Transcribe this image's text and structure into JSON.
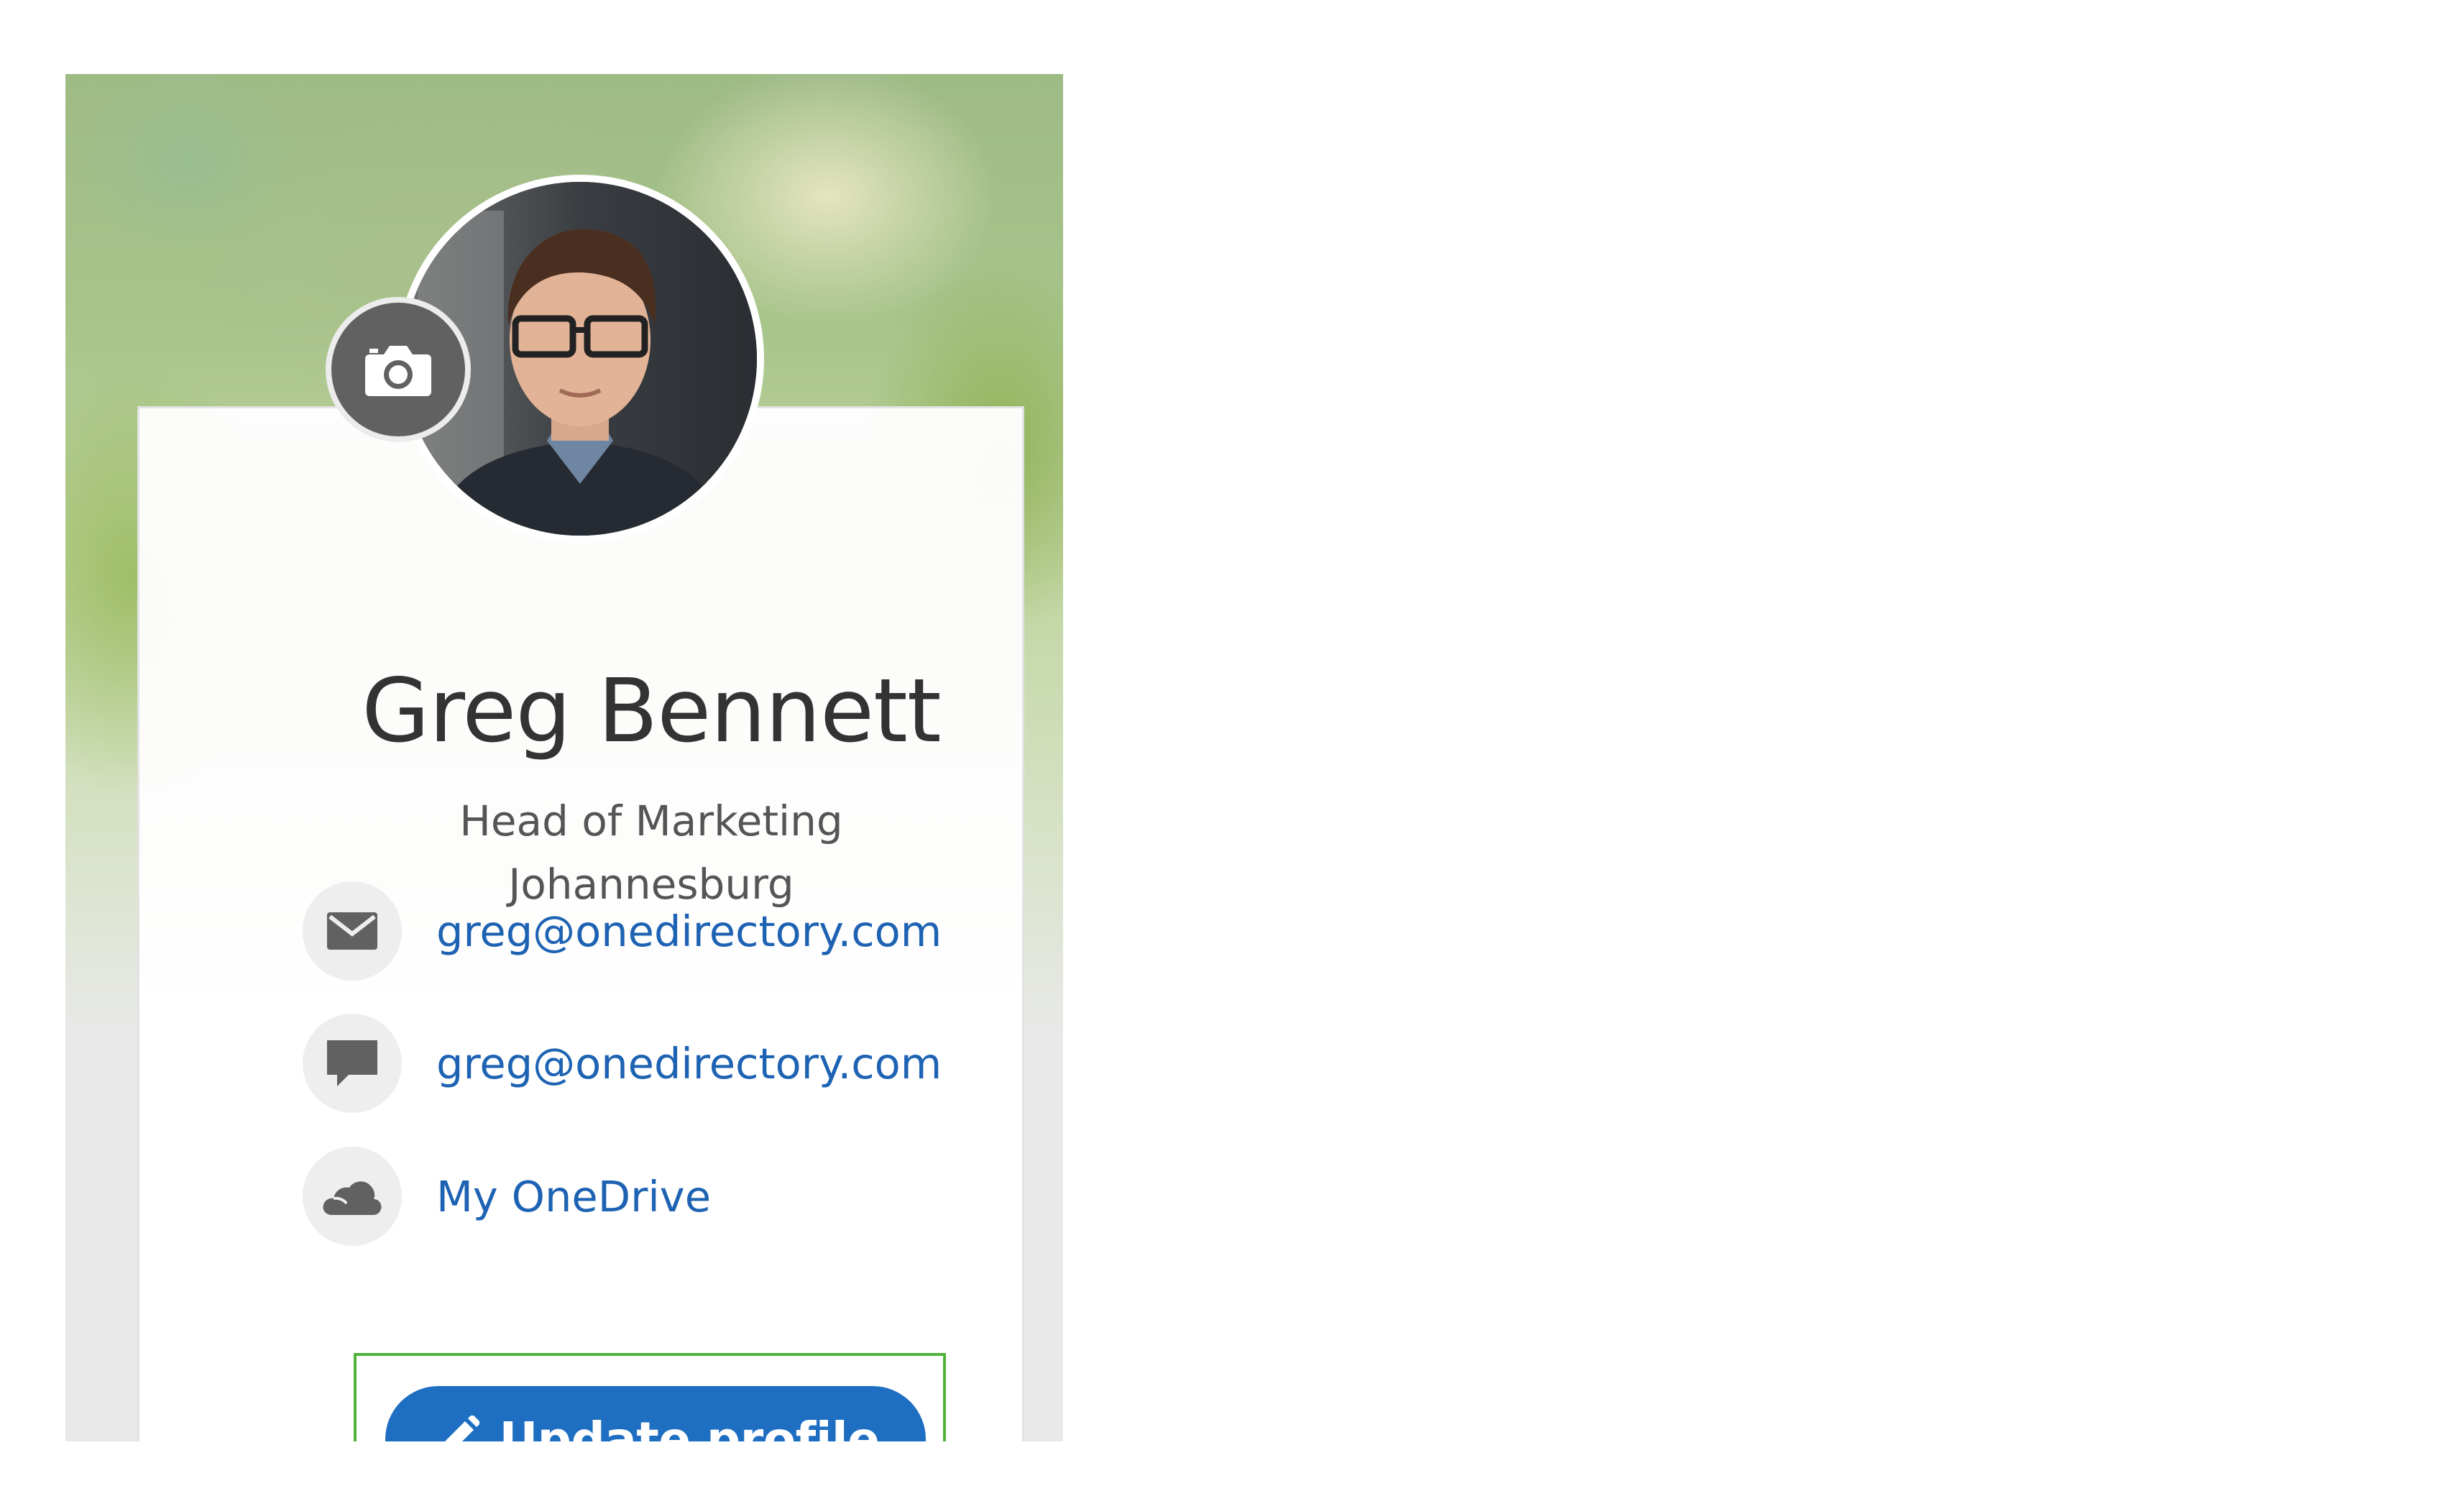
{
  "profile": {
    "name": "Greg Bennett",
    "title": "Head of Marketing",
    "location": "Johannesburg",
    "avatar_icon": "profile-photo",
    "change_photo_icon": "camera-icon"
  },
  "contacts": [
    {
      "icon": "mail-icon",
      "label": "greg@onedirectory.com"
    },
    {
      "icon": "chat-icon",
      "label": "greg@onedirectory.com"
    },
    {
      "icon": "cloud-icon",
      "label": "My OneDrive"
    }
  ],
  "actions": {
    "update_profile_label": "Update profile",
    "update_profile_icon": "pencil-icon"
  },
  "colors": {
    "link": "#1e63b3",
    "button": "#1e6ec1",
    "highlight_frame": "#4fb33a",
    "icon_gray": "#616161"
  }
}
